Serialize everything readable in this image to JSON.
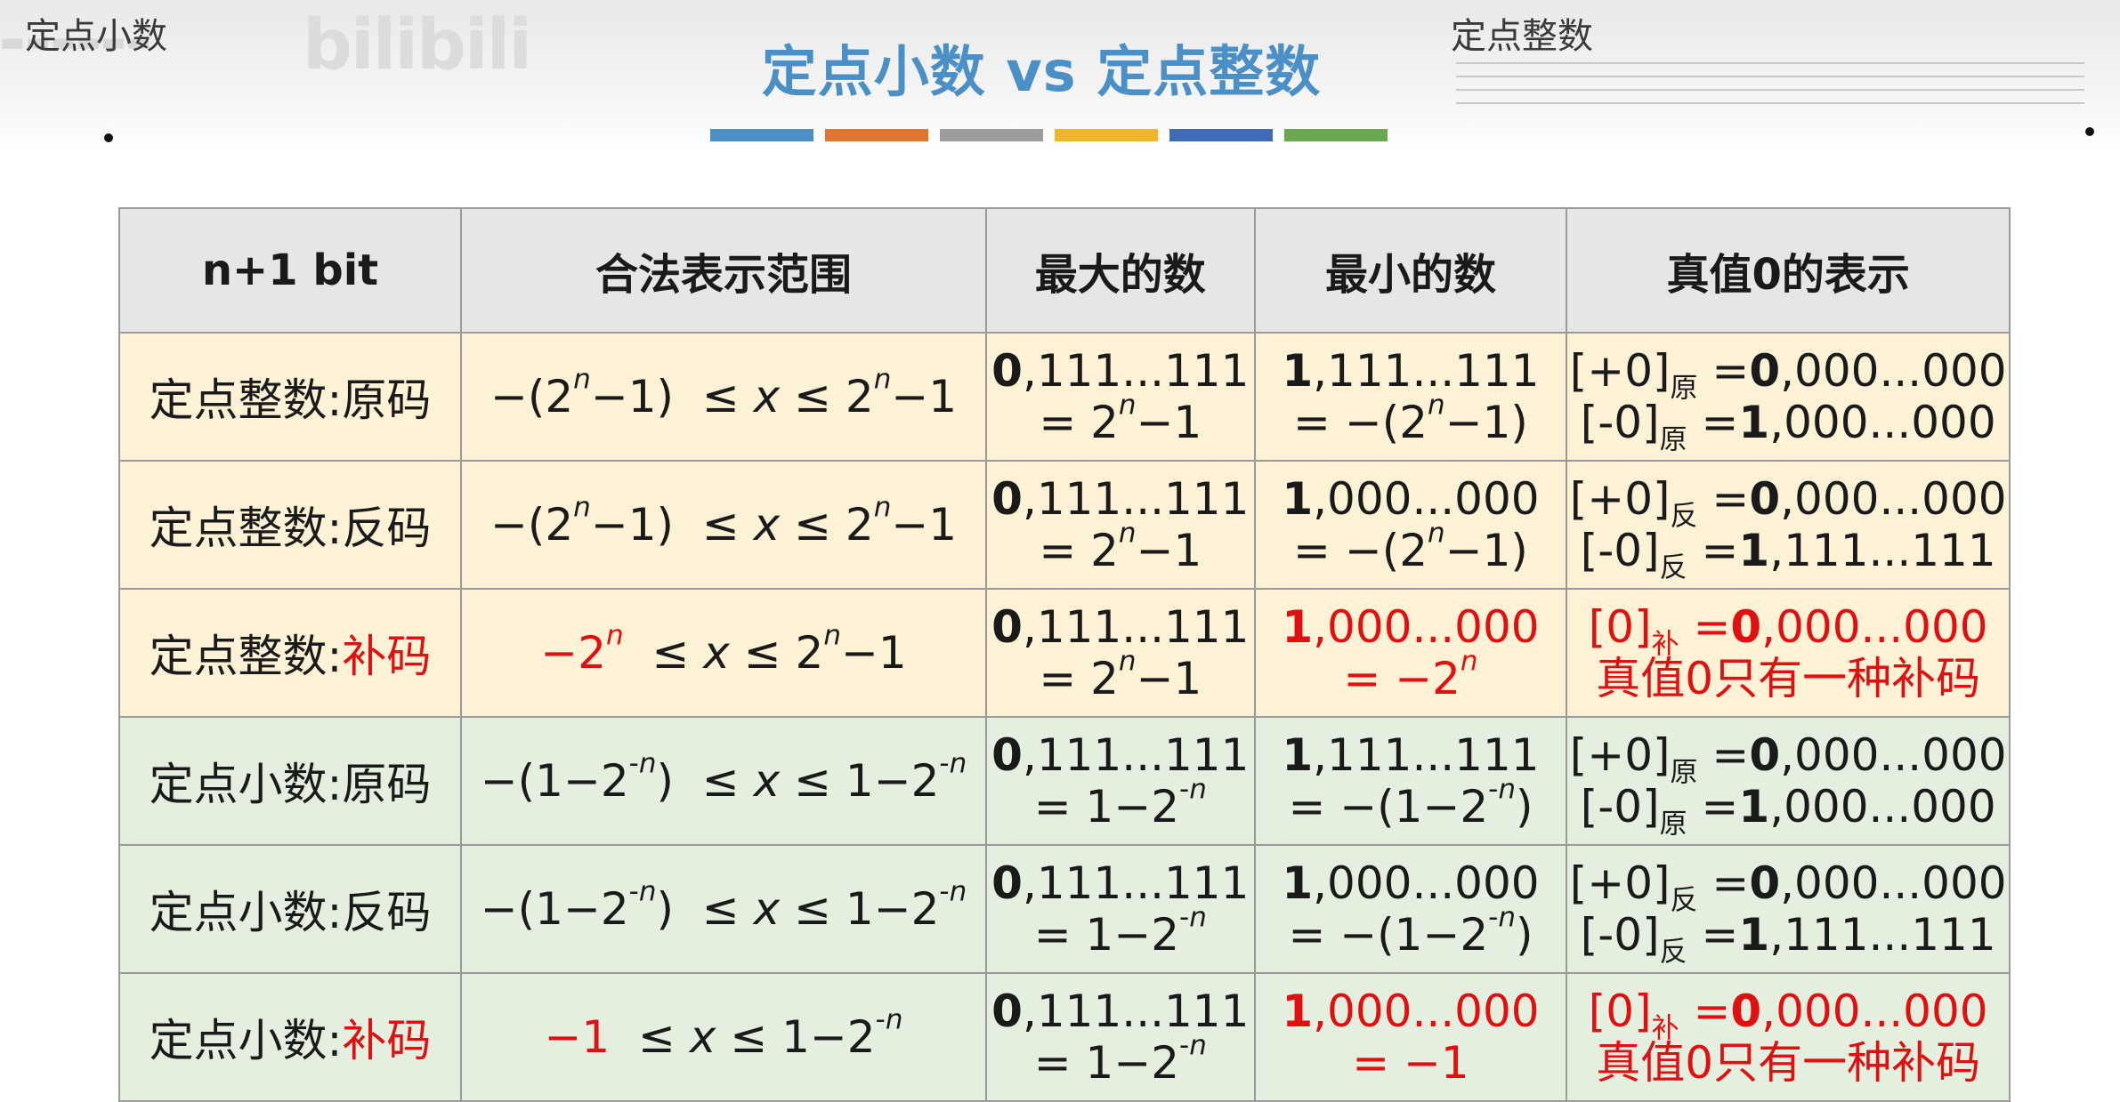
{
  "header": {
    "top_left": "定点小数",
    "top_right": "定点整数",
    "title": "定点小数 vs 定点整数",
    "watermark": "bilibili",
    "accent_colors": [
      "#4a8fc6",
      "#e0752b",
      "#9c9c9c",
      "#f0b52a",
      "#3e6bb5",
      "#6aa84f"
    ]
  },
  "table": {
    "headers": [
      "n+1 bit",
      "合法表示范围",
      "最大的数",
      "最小的数",
      "真值0的表示"
    ],
    "rows": [
      {
        "kind": "int",
        "label_main": "定点整数:",
        "label_code": "原码",
        "label_red": false,
        "range": "−(2ⁿ−1)  ≤ x ≤ 2ⁿ−1",
        "range_red": false,
        "max_l1": "0,111...111",
        "max_l2": "= 2ⁿ−1",
        "min_l1": "1,111...111",
        "min_l2": "= −(2ⁿ−1)",
        "min_red": false,
        "zero_l1": "[+0]原 =0,000...000",
        "zero_l2": "[-0]原 =1,000...000",
        "zero_red": false
      },
      {
        "kind": "int",
        "label_main": "定点整数:",
        "label_code": "反码",
        "label_red": false,
        "range": "−(2ⁿ−1)  ≤ x ≤ 2ⁿ−1",
        "range_red": false,
        "max_l1": "0,111...111",
        "max_l2": "= 2ⁿ−1",
        "min_l1": "1,000...000",
        "min_l2": "= −(2ⁿ−1)",
        "min_red": false,
        "zero_l1": "[+0]反 =0,000...000",
        "zero_l2": "[-0]反 =1,111...111",
        "zero_red": false
      },
      {
        "kind": "int",
        "label_main": "定点整数:",
        "label_code": "补码",
        "label_red": true,
        "range": "−2ⁿ  ≤ x ≤ 2ⁿ−1",
        "range_red": true,
        "max_l1": "0,111...111",
        "max_l2": "= 2ⁿ−1",
        "min_l1": "1,000...000",
        "min_l2": "= −2ⁿ",
        "min_red": true,
        "zero_l1": "[0]补 =0,000...000",
        "zero_l2": "真值0只有一种补码",
        "zero_red": true
      },
      {
        "kind": "frac",
        "label_main": "定点小数:",
        "label_code": "原码",
        "label_red": false,
        "range": "−(1−2⁻ⁿ)  ≤ x ≤ 1−2⁻ⁿ",
        "range_red": false,
        "max_l1": "0,111...111",
        "max_l2": "= 1−2⁻ⁿ",
        "min_l1": "1,111...111",
        "min_l2": "= −(1−2⁻ⁿ)",
        "min_red": false,
        "zero_l1": "[+0]原 =0,000...000",
        "zero_l2": "[-0]原 =1,000...000",
        "zero_red": false
      },
      {
        "kind": "frac",
        "label_main": "定点小数:",
        "label_code": "反码",
        "label_red": false,
        "range": "−(1−2⁻ⁿ)  ≤ x ≤ 1−2⁻ⁿ",
        "range_red": false,
        "max_l1": "0,111...111",
        "max_l2": "= 1−2⁻ⁿ",
        "min_l1": "1,000...000",
        "min_l2": "= −(1−2⁻ⁿ)",
        "min_red": false,
        "zero_l1": "[+0]反 =0,000...000",
        "zero_l2": "[-0]反 =1,111...111",
        "zero_red": false
      },
      {
        "kind": "frac",
        "label_main": "定点小数:",
        "label_code": "补码",
        "label_red": true,
        "range": "−1  ≤ x ≤ 1−2⁻ⁿ",
        "range_red": true,
        "max_l1": "0,111...111",
        "max_l2": "= 1−2⁻ⁿ",
        "min_l1": "1,000...000",
        "min_l2": "= −1",
        "min_red": true,
        "zero_l1": "[0]补 =0,000...000",
        "zero_l2": "真值0只有一种补码",
        "zero_red": true
      }
    ]
  }
}
